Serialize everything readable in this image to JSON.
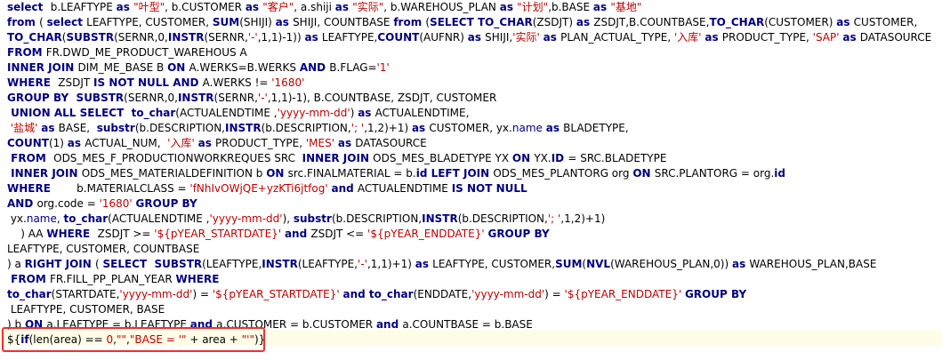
{
  "editor": {
    "lines": [
      [
        [
          "kw",
          "select  "
        ],
        [
          "p",
          "b.LEAFTYPE "
        ],
        [
          "kw",
          "as "
        ],
        [
          "s",
          "\"叶型\""
        ],
        [
          "p",
          ", b.CUSTOMER "
        ],
        [
          "kw",
          "as "
        ],
        [
          "s",
          "\"客户\""
        ],
        [
          "p",
          ", a.shiji "
        ],
        [
          "kw",
          "as "
        ],
        [
          "s",
          "\"实际\""
        ],
        [
          "p",
          ", b.WAREHOUS_PLAN "
        ],
        [
          "kw",
          "as "
        ],
        [
          "s",
          "\"计划\""
        ],
        [
          "p",
          ",b.BASE "
        ],
        [
          "kw",
          "as "
        ],
        [
          "s",
          "\"基地\""
        ]
      ],
      [
        [
          "kw",
          "from "
        ],
        [
          "p",
          "( "
        ],
        [
          "kw",
          "select "
        ],
        [
          "p",
          "LEAFTYPE, CUSTOMER, "
        ],
        [
          "kw",
          "SUM"
        ],
        [
          "p",
          "(SHIJI) "
        ],
        [
          "kw",
          "as "
        ],
        [
          "p",
          "SHIJI, COUNTBASE "
        ],
        [
          "kw",
          "from "
        ],
        [
          "p",
          "("
        ],
        [
          "kw",
          "SELECT "
        ],
        [
          "kw",
          "TO_CHAR"
        ],
        [
          "p",
          "(ZSDJT) "
        ],
        [
          "kw",
          "as "
        ],
        [
          "p",
          "ZSDJT,B.COUNTBASE,"
        ],
        [
          "kw",
          "TO_CHAR"
        ],
        [
          "p",
          "(CUSTOMER) "
        ],
        [
          "kw",
          "as "
        ],
        [
          "p",
          "CUSTOMER,"
        ]
      ],
      [
        [
          "kw",
          "TO_CHAR"
        ],
        [
          "p",
          "("
        ],
        [
          "kw",
          "SUBSTR"
        ],
        [
          "p",
          "(SERNR,0,"
        ],
        [
          "kw",
          "INSTR"
        ],
        [
          "p",
          "(SERNR,"
        ],
        [
          "s",
          "'-'"
        ],
        [
          "p",
          ",1,1)-1)) "
        ],
        [
          "kw",
          "as "
        ],
        [
          "p",
          "LEAFTYPE,"
        ],
        [
          "kw",
          "COUNT"
        ],
        [
          "p",
          "(AUFNR) "
        ],
        [
          "kw",
          "as "
        ],
        [
          "p",
          "SHIJI,"
        ],
        [
          "s",
          "'实际' "
        ],
        [
          "kw",
          "as "
        ],
        [
          "p",
          "PLAN_ACTUAL_TYPE, "
        ],
        [
          "s",
          "'入库' "
        ],
        [
          "kw",
          "as "
        ],
        [
          "p",
          "PRODUCT_TYPE, "
        ],
        [
          "s",
          "'SAP' "
        ],
        [
          "kw",
          "as "
        ],
        [
          "p",
          "DATASOURCE"
        ]
      ],
      [
        [
          "kw",
          "FROM "
        ],
        [
          "p",
          "FR.DWD_ME_PRODUCT_WAREHOUS A"
        ]
      ],
      [
        [
          "kw",
          "INNER JOIN "
        ],
        [
          "p",
          "DIM_ME_BASE B "
        ],
        [
          "kw",
          "ON "
        ],
        [
          "p",
          "A.WERKS=B.WERKS "
        ],
        [
          "kw",
          "AND "
        ],
        [
          "p",
          "B.FLAG="
        ],
        [
          "s",
          "'1'"
        ]
      ],
      [
        [
          "kw",
          "WHERE  "
        ],
        [
          "p",
          "ZSDJT "
        ],
        [
          "kw",
          "IS NOT NULL AND "
        ],
        [
          "p",
          "A.WERKS != "
        ],
        [
          "s",
          "'1680'"
        ]
      ],
      [
        [
          "kw",
          "GROUP BY  "
        ],
        [
          "kw",
          "SUBSTR"
        ],
        [
          "p",
          "(SERNR,0,"
        ],
        [
          "kw",
          "INSTR"
        ],
        [
          "p",
          "(SERNR,"
        ],
        [
          "s",
          "'-'"
        ],
        [
          "p",
          ",1,1)-1), B.COUNTBASE, ZSDJT, CUSTOMER"
        ]
      ],
      [
        [
          "kw",
          " UNION ALL SELECT  "
        ],
        [
          "kw",
          "to_char"
        ],
        [
          "p",
          "(ACTUALENDTIME ,"
        ],
        [
          "s",
          "'yyyy-mm-dd'"
        ],
        [
          "p",
          ") "
        ],
        [
          "kw",
          "as "
        ],
        [
          "p",
          "ACTUALENDTIME,"
        ]
      ],
      [
        [
          "s",
          " '盐城' "
        ],
        [
          "kw",
          "as "
        ],
        [
          "p",
          "BASE,  "
        ],
        [
          "kw",
          "substr"
        ],
        [
          "p",
          "(b.DESCRIPTION,"
        ],
        [
          "kw",
          "INSTR"
        ],
        [
          "p",
          "(b.DESCRIPTION,"
        ],
        [
          "s",
          "'; '"
        ],
        [
          "p",
          ",1,2)+1) "
        ],
        [
          "kw",
          "as "
        ],
        [
          "p",
          "CUSTOMER, yx."
        ],
        [
          "n",
          "name "
        ],
        [
          "kw",
          "as "
        ],
        [
          "p",
          "BLADETYPE,"
        ]
      ],
      [
        [
          "kw",
          "COUNT"
        ],
        [
          "p",
          "(1) "
        ],
        [
          "kw",
          "as "
        ],
        [
          "p",
          "ACTUAL_NUM,  "
        ],
        [
          "s",
          "'入库' "
        ],
        [
          "kw",
          "as "
        ],
        [
          "p",
          "PRODUCT_TYPE, "
        ],
        [
          "s",
          "'MES' "
        ],
        [
          "kw",
          "as "
        ],
        [
          "p",
          "DATASOURCE"
        ]
      ],
      [
        [
          "kw",
          " FROM  "
        ],
        [
          "p",
          "ODS_MES_F_PRODUCTIONWORKREQUES SRC  "
        ],
        [
          "kw",
          "INNER JOIN "
        ],
        [
          "p",
          "ODS_MES_BLADETYPE YX "
        ],
        [
          "kw",
          "ON "
        ],
        [
          "p",
          "YX."
        ],
        [
          "kw",
          "ID "
        ],
        [
          "p",
          "= SRC.BLADETYPE"
        ]
      ],
      [
        [
          "kw",
          " INNER JOIN "
        ],
        [
          "p",
          "ODS_MES_MATERIALDEFINITION b "
        ],
        [
          "kw",
          "ON "
        ],
        [
          "p",
          "src.FINALMATERIAL = b."
        ],
        [
          "kw",
          "id LEFT JOIN "
        ],
        [
          "p",
          "ODS_MES_PLANTORG org "
        ],
        [
          "kw",
          "ON "
        ],
        [
          "p",
          "SRC.PLANTORG = org."
        ],
        [
          "kw",
          "id"
        ]
      ],
      [
        [
          "kw",
          "WHERE       "
        ],
        [
          "p",
          "b.MATERIALCLASS = "
        ],
        [
          "s",
          "'fNhIvOWjQE+yzKTi6jtfog' "
        ],
        [
          "kw",
          "and "
        ],
        [
          "p",
          "ACTUALENDTIME "
        ],
        [
          "kw",
          "IS NOT NULL"
        ]
      ],
      [
        [
          "kw",
          "AND "
        ],
        [
          "p",
          "org.code = "
        ],
        [
          "s",
          "'1680' "
        ],
        [
          "kw",
          "GROUP BY"
        ]
      ],
      [
        [
          "p",
          " yx."
        ],
        [
          "n",
          "name"
        ],
        [
          "p",
          ", "
        ],
        [
          "kw",
          "to_char"
        ],
        [
          "p",
          "(ACTUALENDTIME ,"
        ],
        [
          "s",
          "'yyyy-mm-dd'"
        ],
        [
          "p",
          "), "
        ],
        [
          "kw",
          "substr"
        ],
        [
          "p",
          "(b.DESCRIPTION,"
        ],
        [
          "kw",
          "INSTR"
        ],
        [
          "p",
          "(b.DESCRIPTION,"
        ],
        [
          "s",
          "'; '"
        ],
        [
          "p",
          ",1,2)+1)"
        ]
      ],
      [
        [
          "p",
          "    ) AA "
        ],
        [
          "kw",
          "WHERE  "
        ],
        [
          "p",
          "ZSDJT >= "
        ],
        [
          "s",
          "'${pYEAR_STARTDATE}' "
        ],
        [
          "kw",
          "and "
        ],
        [
          "p",
          "ZSDJT <= "
        ],
        [
          "s",
          "'${pYEAR_ENDDATE}' "
        ],
        [
          "kw",
          "GROUP BY"
        ]
      ],
      [
        [
          "p",
          "LEAFTYPE, CUSTOMER, COUNTBASE"
        ]
      ],
      [
        [
          "p",
          ") a "
        ],
        [
          "kw",
          "RIGHT JOIN "
        ],
        [
          "p",
          "( "
        ],
        [
          "kw",
          "SELECT  "
        ],
        [
          "kw",
          "SUBSTR"
        ],
        [
          "p",
          "(LEAFTYPE,"
        ],
        [
          "kw",
          "INSTR"
        ],
        [
          "p",
          "(LEAFTYPE,"
        ],
        [
          "s",
          "'-'"
        ],
        [
          "p",
          ",1,1)+1) "
        ],
        [
          "kw",
          "as "
        ],
        [
          "p",
          "LEAFTYPE, CUSTOMER,"
        ],
        [
          "kw",
          "SUM"
        ],
        [
          "p",
          "("
        ],
        [
          "kw",
          "NVL"
        ],
        [
          "p",
          "(WAREHOUS_PLAN,0)) "
        ],
        [
          "kw",
          "as "
        ],
        [
          "p",
          "WAREHOUS_PLAN,BASE"
        ]
      ],
      [
        [
          "kw",
          " FROM "
        ],
        [
          "p",
          "FR.FILL_PP_PLAN_YEAR "
        ],
        [
          "kw",
          "WHERE"
        ]
      ],
      [
        [
          "kw",
          "to_char"
        ],
        [
          "p",
          "(STARTDATE,"
        ],
        [
          "s",
          "'yyyy-mm-dd'"
        ],
        [
          "p",
          ") = "
        ],
        [
          "s",
          "'${pYEAR_STARTDATE}' "
        ],
        [
          "kw",
          "and "
        ],
        [
          "kw",
          "to_char"
        ],
        [
          "p",
          "(ENDDATE,"
        ],
        [
          "s",
          "'yyyy-mm-dd'"
        ],
        [
          "p",
          ") = "
        ],
        [
          "s",
          "'${pYEAR_ENDDATE}' "
        ],
        [
          "kw",
          "GROUP BY"
        ]
      ],
      [
        [
          "p",
          " LEAFTYPE, CUSTOMER, BASE"
        ]
      ],
      [
        [
          "p",
          ") b "
        ],
        [
          "kw",
          "ON "
        ],
        [
          "p",
          "a.LEAFTYPE = b.LEAFTYPE "
        ],
        [
          "kw",
          "and "
        ],
        [
          "p",
          "a.CUSTOMER = b.CUSTOMER "
        ],
        [
          "kw",
          "and "
        ],
        [
          "p",
          "a.COUNTBASE = b.BASE"
        ]
      ],
      [
        [
          "p",
          "${"
        ],
        [
          "kw",
          "if"
        ],
        [
          "p",
          "(len(area) == "
        ],
        [
          "s",
          "0"
        ],
        [
          "p",
          ","
        ],
        [
          "s",
          "\"\""
        ],
        [
          "p",
          ","
        ],
        [
          "s",
          "\"BASE = '\""
        ],
        [
          "p",
          " + area + "
        ],
        [
          "s",
          "\"'\""
        ],
        [
          "p",
          ")}"
        ]
      ]
    ]
  }
}
